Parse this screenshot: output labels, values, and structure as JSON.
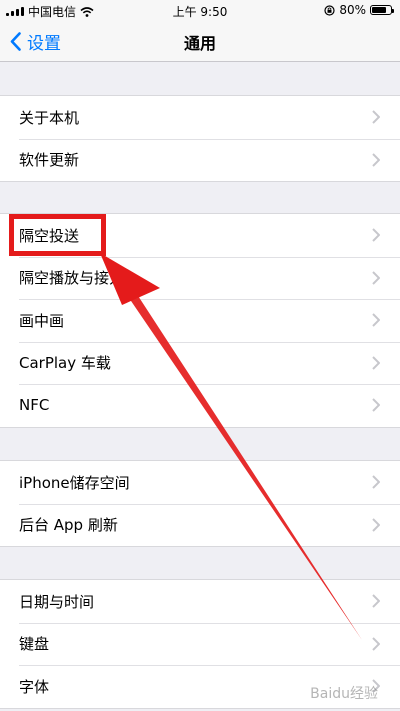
{
  "status_bar": {
    "carrier": "中国电信",
    "time": "上午 9:50",
    "battery_percent": "80%",
    "battery_level": 0.8,
    "icons": [
      "signal-icon",
      "wifi-icon",
      "orientation-lock-icon",
      "battery-icon"
    ]
  },
  "nav": {
    "back_label": "设置",
    "title": "通用"
  },
  "groups": [
    {
      "items": [
        {
          "label": "关于本机"
        },
        {
          "label": "软件更新"
        }
      ]
    },
    {
      "items": [
        {
          "label": "隔空投送"
        },
        {
          "label": "隔空播放与接力"
        },
        {
          "label": "画中画"
        },
        {
          "label": "CarPlay 车载"
        },
        {
          "label": "NFC"
        }
      ]
    },
    {
      "items": [
        {
          "label": "iPhone储存空间"
        },
        {
          "label": "后台 App 刷新"
        }
      ]
    },
    {
      "items": [
        {
          "label": "日期与时间"
        },
        {
          "label": "键盘"
        },
        {
          "label": "字体"
        }
      ]
    }
  ],
  "annotation": {
    "highlighted_item": "隔空投送",
    "color": "#e41b1b"
  },
  "watermark": "Baidu经验",
  "colors": {
    "accent": "#007aff",
    "background": "#efeff4",
    "chevron": "#c7c7cc"
  }
}
